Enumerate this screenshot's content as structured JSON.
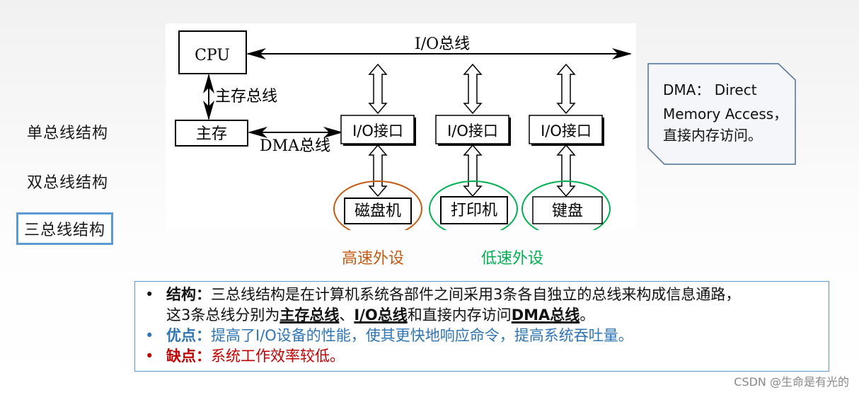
{
  "nav": {
    "items": [
      {
        "label": "单总线结构",
        "active": false
      },
      {
        "label": "双总线结构",
        "active": false
      },
      {
        "label": "三总线结构",
        "active": true
      }
    ]
  },
  "diagram": {
    "cpu": "CPU",
    "memory": "主存",
    "memory_bus": "主存总线",
    "io_bus": "I/O总线",
    "dma_bus": "DMA总线",
    "io_interfaces": [
      "I/O接口",
      "I/O接口",
      "I/O接口"
    ],
    "devices": [
      "磁盘机",
      "打印机",
      "键盘"
    ],
    "high_speed_color": "#c55a11",
    "low_speed_color": "#00b050"
  },
  "groups": {
    "high_speed": "高速外设",
    "low_speed": "低速外设"
  },
  "callout": {
    "line1": "DMA： Direct",
    "line2": "Memory Access，",
    "line3": "直接内存访问。"
  },
  "notes": {
    "structure": {
      "label": "结构：",
      "text1": "三总线结构是在计算机系统各部件之间采用3条各自独立的总线来构成信息通路，",
      "text2": "这3条总线分别为",
      "term1": "主存总线",
      "sep1": "、",
      "term2": "I/O总线",
      "sep2": "和直接内存访问",
      "term3": "DMA总线",
      "end": "。"
    },
    "pros": {
      "label": "优点：",
      "text": "提高了I/O设备的性能，使其更快地响应命令，提高系统吞吐量。",
      "color": "#2e75b6"
    },
    "cons": {
      "label": "缺点：",
      "text": "系统工作效率较低。",
      "color": "#c00000"
    }
  },
  "watermark": "CSDN @生命是有光的"
}
